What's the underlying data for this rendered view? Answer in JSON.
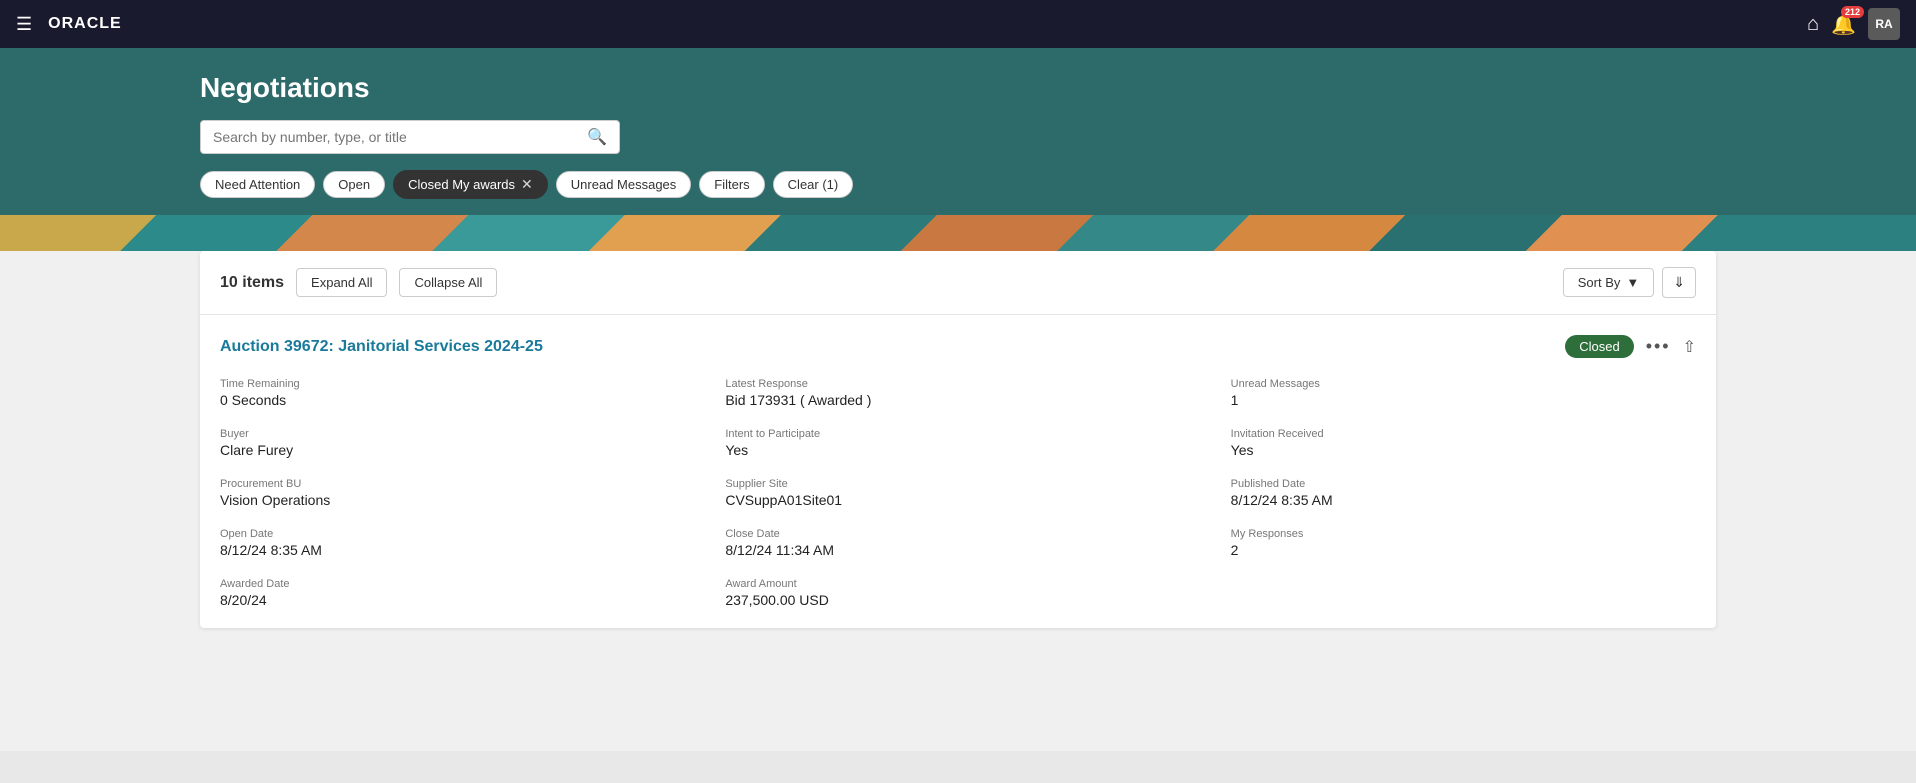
{
  "nav": {
    "hamburger_icon": "☰",
    "logo": "ORACLE",
    "home_icon": "⌂",
    "notification_icon": "🔔",
    "notification_count": "212",
    "avatar_initials": "RA"
  },
  "header": {
    "title": "Negotiations",
    "search_placeholder": "Search by number, type, or title"
  },
  "filters": {
    "need_attention_label": "Need Attention",
    "open_label": "Open",
    "closed_my_awards_label": "Closed My awards",
    "unread_messages_label": "Unread Messages",
    "filters_label": "Filters",
    "clear_label": "Clear (1)"
  },
  "content": {
    "items_count": "10 items",
    "expand_all_label": "Expand All",
    "collapse_all_label": "Collapse All",
    "sort_by_label": "Sort By"
  },
  "auction": {
    "title": "Auction 39672: Janitorial Services 2024-25",
    "status": "Closed",
    "fields": {
      "time_remaining_label": "Time Remaining",
      "time_remaining_value": "0 Seconds",
      "buyer_label": "Buyer",
      "buyer_value": "Clare Furey",
      "procurement_bu_label": "Procurement BU",
      "procurement_bu_value": "Vision Operations",
      "open_date_label": "Open Date",
      "open_date_value": "8/12/24 8:35 AM",
      "awarded_date_label": "Awarded Date",
      "awarded_date_value": "8/20/24",
      "latest_response_label": "Latest Response",
      "latest_response_value": "Bid 173931 ( Awarded )",
      "intent_to_participate_label": "Intent to Participate",
      "intent_to_participate_value": "Yes",
      "supplier_site_label": "Supplier Site",
      "supplier_site_value": "CVSuppA01Site01",
      "close_date_label": "Close Date",
      "close_date_value": "8/12/24 11:34 AM",
      "award_amount_label": "Award Amount",
      "award_amount_value": "237,500.00 USD",
      "unread_messages_label": "Unread Messages",
      "unread_messages_value": "1",
      "invitation_received_label": "Invitation Received",
      "invitation_received_value": "Yes",
      "published_date_label": "Published Date",
      "published_date_value": "8/12/24 8:35 AM",
      "my_responses_label": "My Responses",
      "my_responses_value": "2"
    }
  }
}
